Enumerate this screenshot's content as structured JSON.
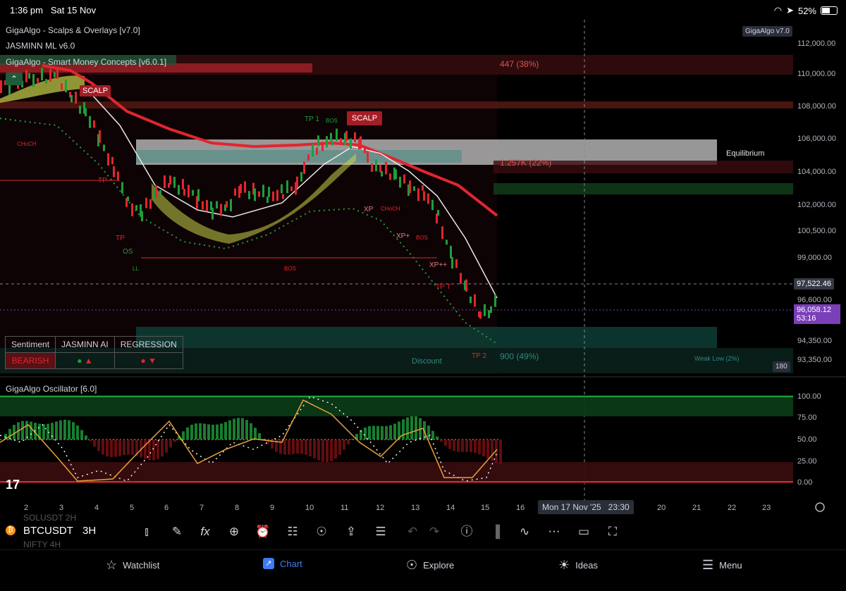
{
  "status": {
    "time": "1:36 pm",
    "date": "Sat 15 Nov",
    "battery": "52%"
  },
  "indicators": {
    "overlay1": "GigaAlgo - Scalps & Overlays [v7.0]",
    "overlay2": "JASMINN ML v6.0",
    "overlay3": "GigaAlgo - Smart Money Concepts [v6.0.1]",
    "oscillator": "GigaAlgo Oscillator [6.0]",
    "badge": "GigaAlgo v7.0"
  },
  "price_axis": {
    "labels": [
      "112,000.00",
      "110,000.00",
      "108,000.00",
      "106,000.00",
      "104,000.00",
      "102,000.00",
      "100,500.00",
      "99,000.00",
      "96,600.00",
      "94,350.00",
      "93,350.00"
    ],
    "crosshair": "97,522.46",
    "current": "96,058.12",
    "countdown": "53:16",
    "small_tag": "180"
  },
  "oscillator_axis": {
    "labels": [
      "100.00",
      "75.00",
      "50.00",
      "25.00",
      "0.00"
    ]
  },
  "annotations": {
    "top_stat": "447 (38%)",
    "mid_stat": "1.257K (22%)",
    "low_stat": "900 (49%)",
    "equilibrium": "Equilibrium",
    "discount": "Discount",
    "weak_low": "Weak Low (2%)",
    "scalp1": "SCALP",
    "scalp2": "SCALP",
    "tp1": "TP 1",
    "bos1": "BOS",
    "bos2": "BOS",
    "bos3": "BOS",
    "choch1": "CHoCH",
    "choch2": "CHoCH",
    "xp1": "XP",
    "xp2": "XP+",
    "xp3": "XP++",
    "tp_left": "TP",
    "tp_low": "TP 2",
    "tp_t": "TP T",
    "os": "OS",
    "ll": "LL",
    "tt": "TP"
  },
  "sentiment_table": {
    "headers": [
      "Sentiment",
      "JASMINN AI",
      "REGRESSION"
    ],
    "sentiment_value": "BEARISH"
  },
  "x_axis": {
    "ticks": [
      "2",
      "3",
      "4",
      "5",
      "6",
      "7",
      "8",
      "9",
      "10",
      "11",
      "12",
      "13",
      "14",
      "15",
      "16",
      "20",
      "21",
      "22",
      "23"
    ],
    "crosshair_label": "Mon 17 Nov '25   23:30"
  },
  "toolbar": {
    "symbol": "BTCUSDT",
    "interval": "3H",
    "ghost1": "SOLUSDT 2H",
    "ghost2": "NIFTY 4H"
  },
  "nav": {
    "watchlist": "Watchlist",
    "chart": "Chart",
    "explore": "Explore",
    "ideas": "Ideas",
    "menu": "Menu"
  },
  "colors": {
    "bull": "#1e9e3c",
    "bear": "#e0262f",
    "accent": "#3d7cf3",
    "current_price_bg": "#7b3fb8",
    "band_yellow": "#c8d34a"
  }
}
